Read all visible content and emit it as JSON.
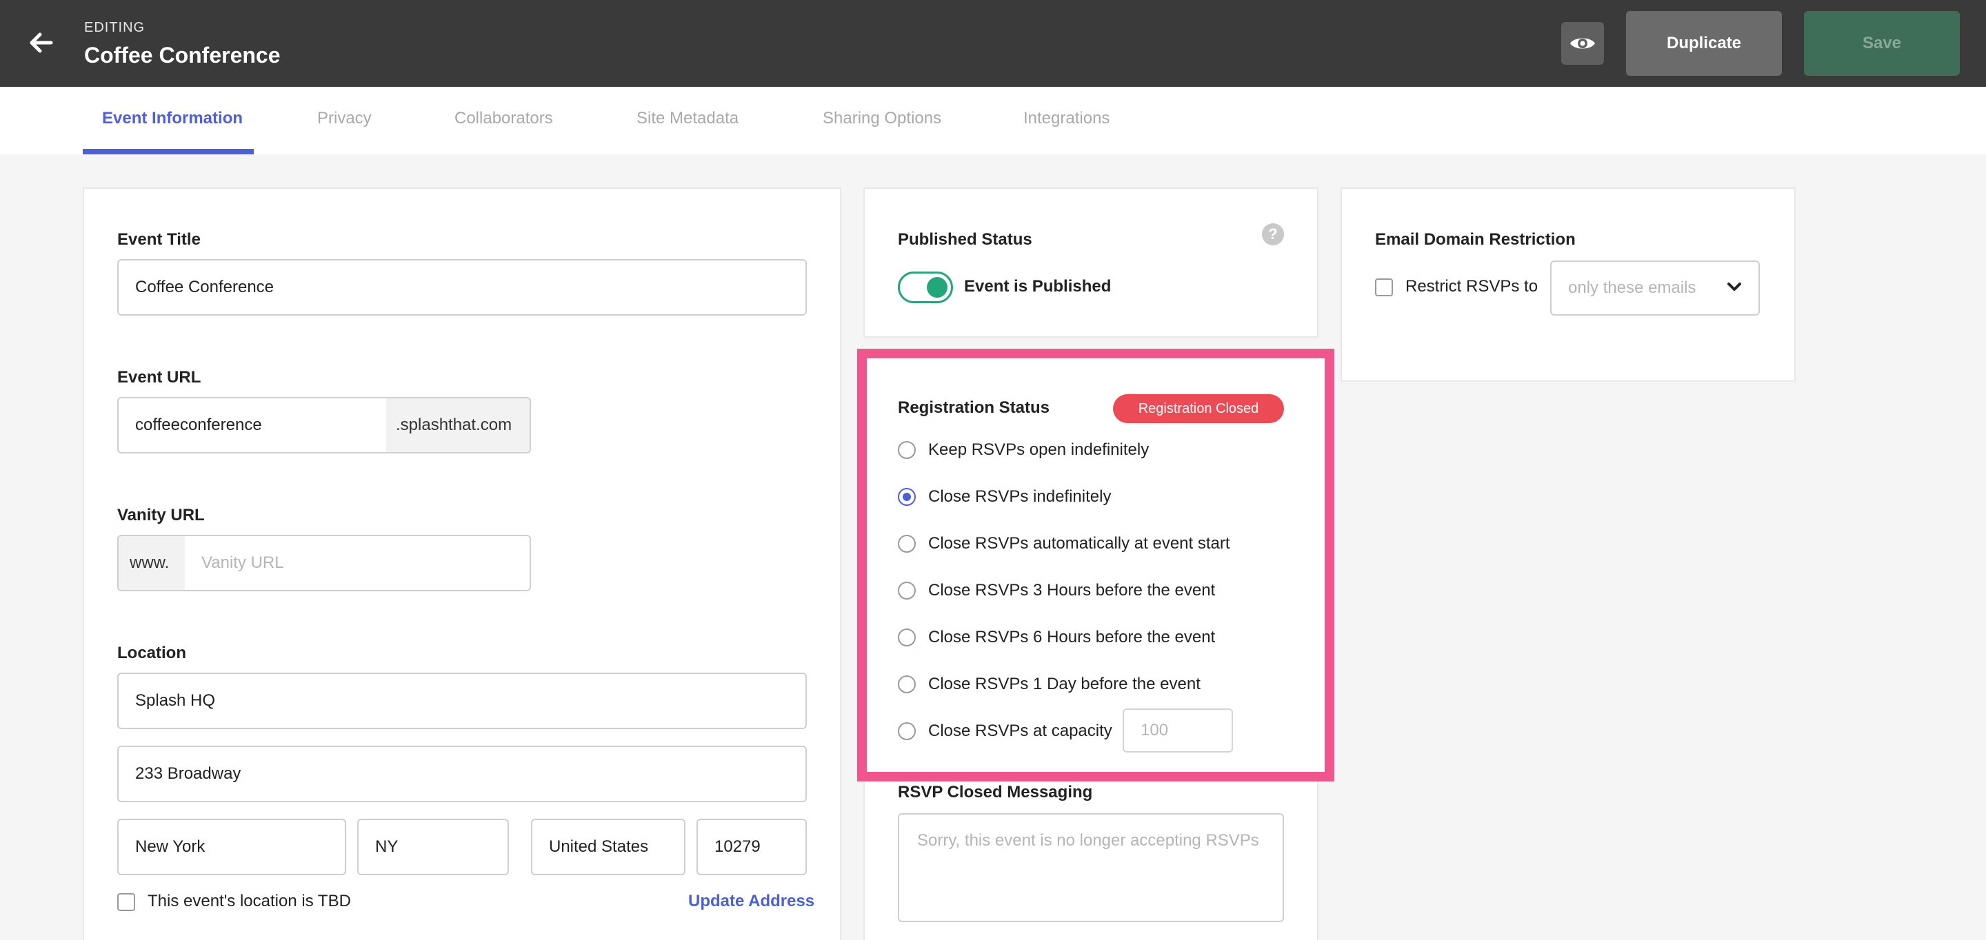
{
  "header": {
    "editing_label": "EDITING",
    "event_name": "Coffee Conference",
    "preview_icon": "eye-icon",
    "back_icon": "arrow-left-icon",
    "duplicate_label": "Duplicate",
    "save_label": "Save"
  },
  "tabs": [
    {
      "label": "Event Information",
      "active": true
    },
    {
      "label": "Privacy"
    },
    {
      "label": "Collaborators"
    },
    {
      "label": "Site Metadata"
    },
    {
      "label": "Sharing Options"
    },
    {
      "label": "Integrations"
    }
  ],
  "event_info": {
    "title_label": "Event Title",
    "title_value": "Coffee Conference",
    "url_label": "Event URL",
    "url_value": "coffeeconference",
    "url_suffix": ".splashthat.com",
    "vanity_label": "Vanity URL",
    "vanity_prefix": "www.",
    "vanity_placeholder": "Vanity URL",
    "location_label": "Location",
    "venue": "Splash HQ",
    "address": "233 Broadway",
    "city": "New York",
    "state": "NY",
    "country": "United States",
    "zip": "10279",
    "tbd_label": "This event's location is TBD",
    "update_address": "Update Address"
  },
  "published": {
    "label": "Published Status",
    "toggle_label": "Event is Published",
    "help_glyph": "?"
  },
  "registration": {
    "label": "Registration Status",
    "badge": "Registration Closed",
    "options": [
      {
        "label": "Keep RSVPs open indefinitely",
        "checked": false
      },
      {
        "label": "Close RSVPs indefinitely",
        "checked": true
      },
      {
        "label": "Close RSVPs automatically at event start",
        "checked": false
      },
      {
        "label": "Close RSVPs 3 Hours before the event",
        "checked": false
      },
      {
        "label": "Close RSVPs 6 Hours before the event",
        "checked": false
      },
      {
        "label": "Close RSVPs 1 Day before the event",
        "checked": false
      },
      {
        "label": "Close RSVPs at capacity",
        "checked": false
      }
    ],
    "capacity_placeholder": "100"
  },
  "closed_messaging": {
    "label": "RSVP Closed Messaging",
    "placeholder": "Sorry, this event is no longer accepting RSVPs"
  },
  "email_domain": {
    "label": "Email Domain Restriction",
    "checkbox_label": "Restrict RSVPs to",
    "select_value": "only these emails"
  },
  "colors": {
    "accent": "#4d5fd8",
    "success": "#22a67a",
    "danger": "#ec4a55",
    "highlight": "#f0568d"
  }
}
